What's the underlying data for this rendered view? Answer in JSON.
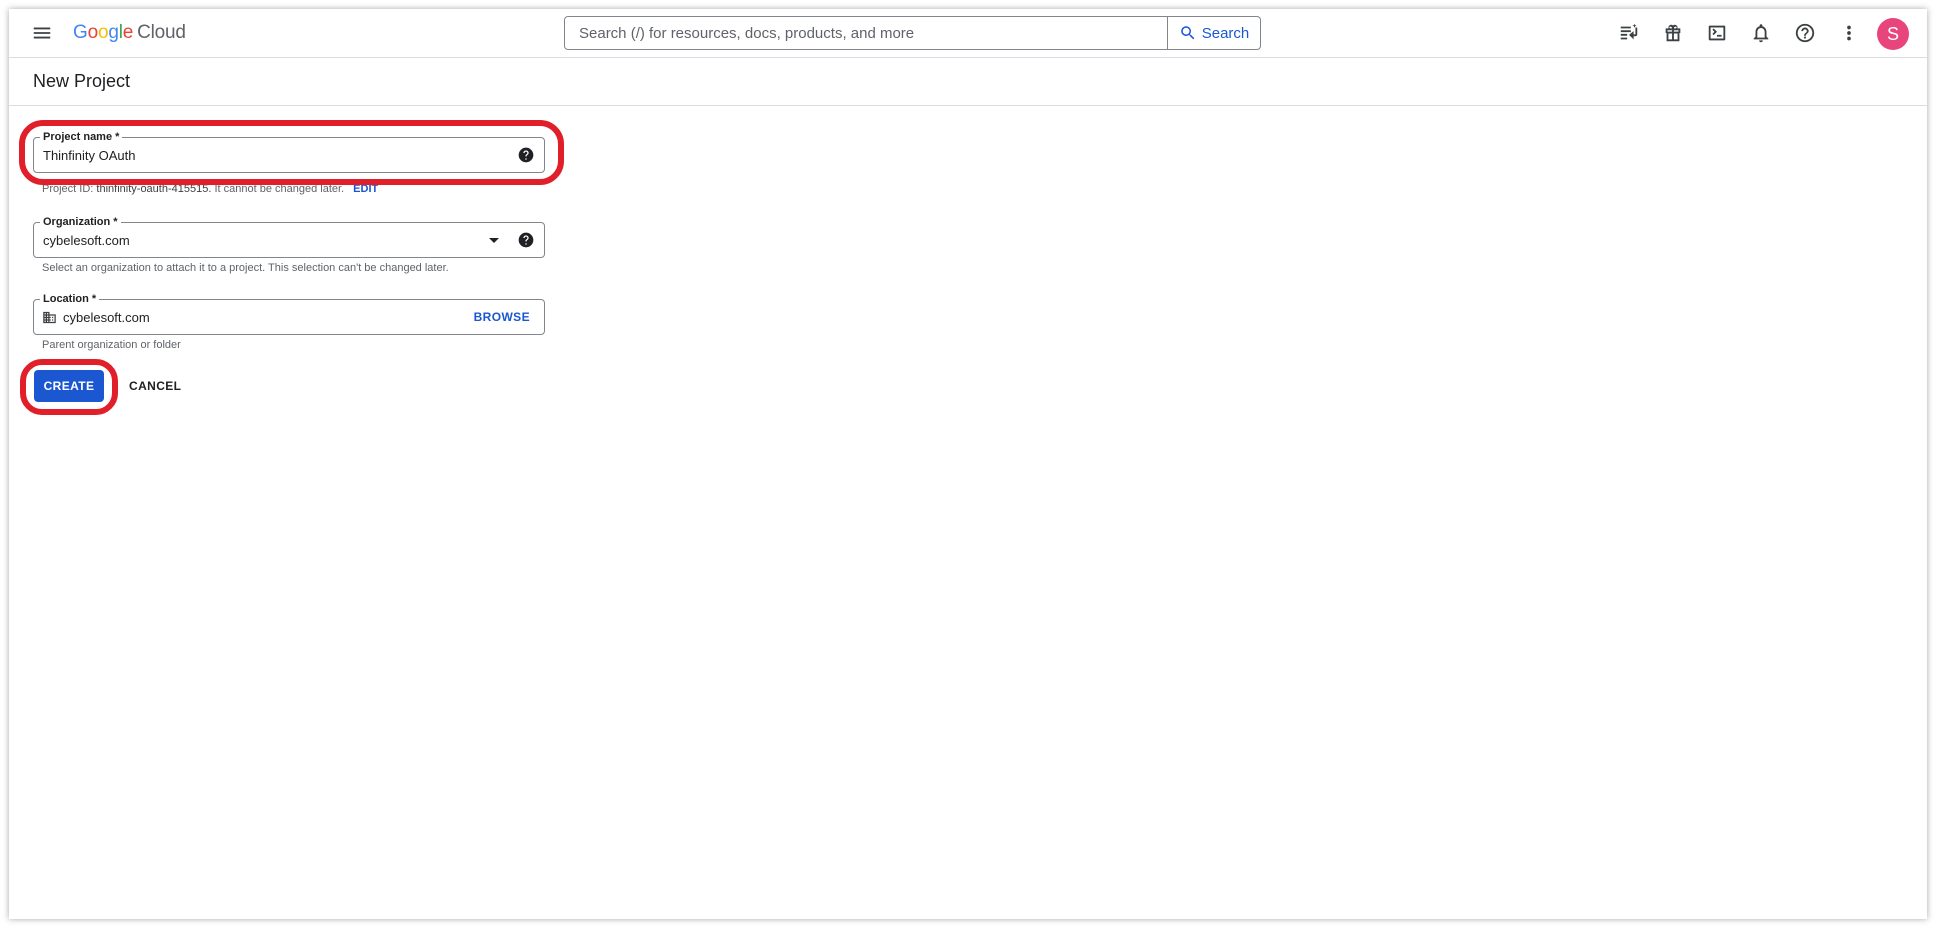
{
  "app": {
    "logo_google": [
      "G",
      "o",
      "o",
      "g",
      "l",
      "e"
    ],
    "logo_cloud": "Cloud",
    "logo_colors": [
      "#4285F4",
      "#EA4335",
      "#FBBC05",
      "#4285F4",
      "#34A853",
      "#EA4335"
    ]
  },
  "header": {
    "search_placeholder": "Search (/) for resources, docs, products, and more",
    "search_button": "Search",
    "avatar_letter": "S",
    "avatar_color": "#e8457d",
    "icons": [
      "menu-icon",
      "release-notes-icon",
      "gift-icon",
      "cloud-shell-icon",
      "notifications-icon",
      "help-icon",
      "more-vert-icon"
    ]
  },
  "page": {
    "title": "New Project"
  },
  "form": {
    "project_name": {
      "label": "Project name *",
      "value": "Thinfinity OAuth",
      "hint_prefix": "Project ID:",
      "hint_id": "thinfinity-oauth-415515.",
      "hint_suffix": "It cannot be changed later.",
      "edit_link": "EDIT"
    },
    "organization": {
      "label": "Organization *",
      "value": "cybelesoft.com",
      "hint": "Select an organization to attach it to a project. This selection can't be changed later."
    },
    "location": {
      "label": "Location *",
      "value": "cybelesoft.com",
      "browse": "BROWSE",
      "hint": "Parent organization or folder"
    },
    "create_button": "CREATE",
    "cancel_button": "CANCEL"
  },
  "colors": {
    "accent": "#1a57d1",
    "highlight": "#e01f2b"
  }
}
